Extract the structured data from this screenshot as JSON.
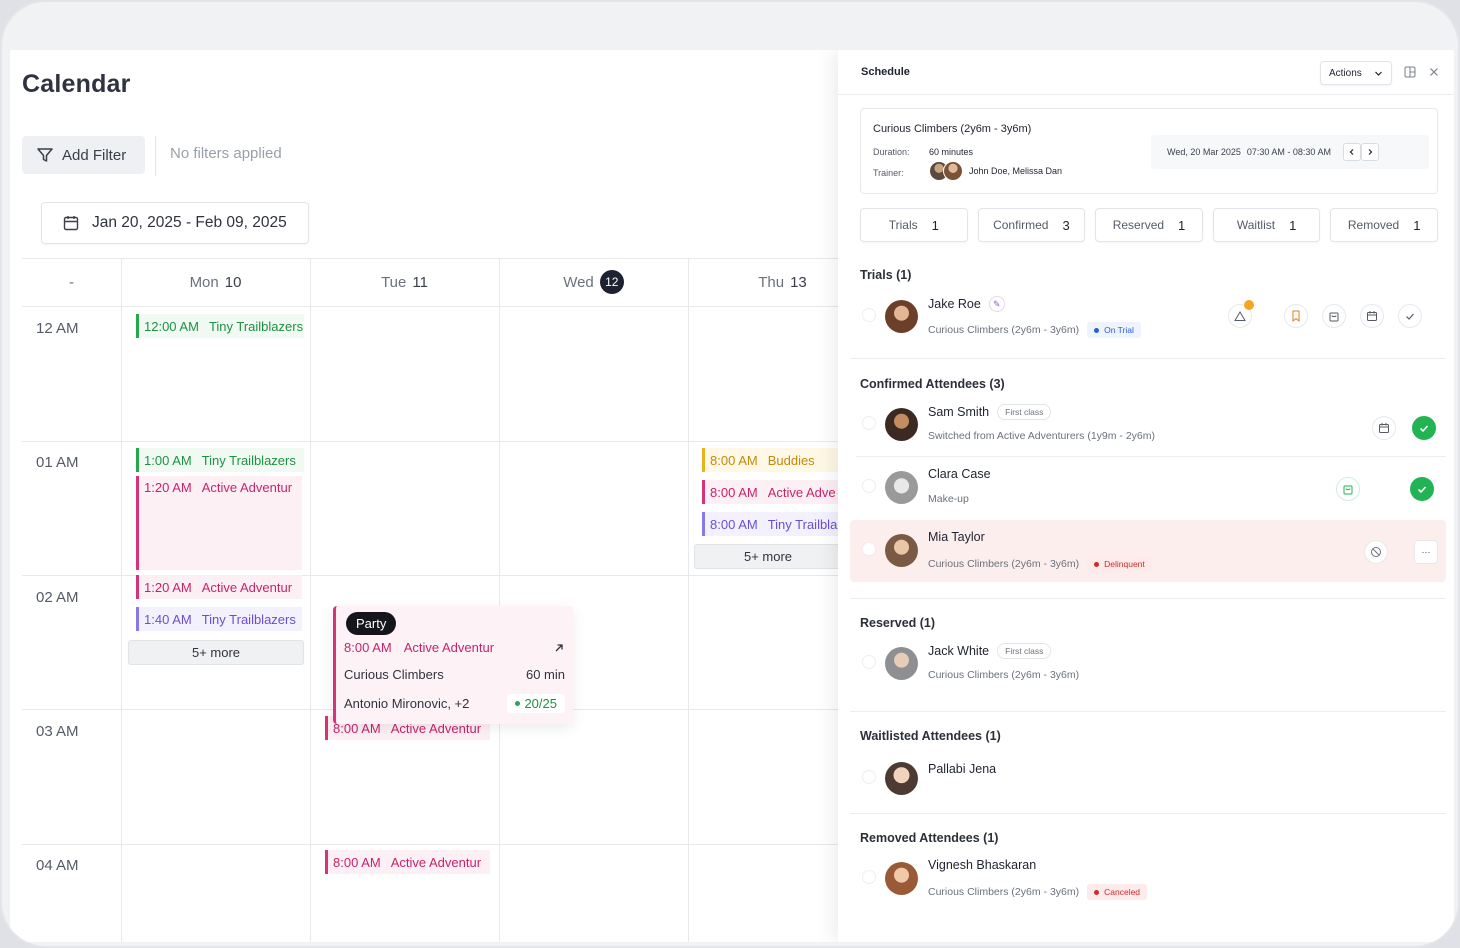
{
  "calendar": {
    "title": "Calendar",
    "add_filter": "Add Filter",
    "no_filters": "No filters applied",
    "date_range": "Jan 20, 2025 - Feb 09, 2025",
    "corner": "-",
    "days": [
      {
        "name": "Mon",
        "num": "10"
      },
      {
        "name": "Tue",
        "num": "11"
      },
      {
        "name": "Wed",
        "num": "12"
      },
      {
        "name": "Thu",
        "num": "13"
      }
    ],
    "hours": [
      "12 AM",
      "01 AM",
      "02 AM",
      "03 AM",
      "04 AM"
    ],
    "events": {
      "mon_1": {
        "time": "12:00 AM",
        "name": "Tiny Trailblazers"
      },
      "mon_2": {
        "time": "1:00 AM",
        "name": "Tiny Trailblazers"
      },
      "mon_3": {
        "time": "1:20 AM",
        "name": "Active Adventur"
      },
      "mon_4": {
        "time": "1:20 AM",
        "name": "Active Adventur"
      },
      "mon_5": {
        "time": "1:40 AM",
        "name": "Tiny Trailblazers"
      },
      "mon_more": "5+ more",
      "thu_1": {
        "time": "8:00 AM",
        "name": "Buddies"
      },
      "thu_2": {
        "time": "8:00 AM",
        "name": "Active Adve"
      },
      "thu_3": {
        "time": "8:00 AM",
        "name": "Tiny Trailbla"
      },
      "thu_more": "5+ more",
      "tue_1": {
        "time": "8:00 AM",
        "name": "Active Adventur"
      },
      "tue_2": {
        "time": "8:00 AM",
        "name": "Active Adventur"
      }
    },
    "party": {
      "pill": "Party",
      "time": "8:00 AM",
      "name": "Active Adventur",
      "class": "Curious Climbers",
      "duration": "60 min",
      "trainers": "Antonio Mironovic, +2",
      "capacity": "20/25"
    }
  },
  "schedule": {
    "title": "Schedule",
    "actions": "Actions",
    "class_name": "Curious Climbers (2y6m - 3y6m)",
    "duration_label": "Duration:",
    "duration": "60 minutes",
    "trainer_label": "Trainer:",
    "trainers": "John Doe, Melissa Dan",
    "date": "Wed, 20 Mar 2025",
    "time": "07:30 AM - 08:30 AM",
    "tabs": [
      {
        "label": "Trials",
        "count": "1"
      },
      {
        "label": "Confirmed",
        "count": "3"
      },
      {
        "label": "Reserved",
        "count": "1"
      },
      {
        "label": "Waitlist",
        "count": "1"
      },
      {
        "label": "Removed",
        "count": "1"
      }
    ],
    "sections": {
      "trials": "Trials (1)",
      "confirmed": "Confirmed Attendees (3)",
      "reserved": "Reserved (1)",
      "waitlisted": "Waitlisted Attendees (1)",
      "removed": "Removed Attendees (1)"
    },
    "attendees": {
      "jake": {
        "name": "Jake Roe",
        "sub": "Curious Climbers (2y6m - 3y6m)",
        "badge": "On Trial"
      },
      "sam": {
        "name": "Sam Smith",
        "tag": "First class",
        "sub": "Switched from Active Adventurers (1y9m - 2y6m)"
      },
      "clara": {
        "name": "Clara Case",
        "sub": "Make-up"
      },
      "mia": {
        "name": "Mia Taylor",
        "sub": "Curious Climbers (2y6m - 3y6m)",
        "badge": "Delinquent"
      },
      "jack": {
        "name": "Jack White",
        "tag": "First class",
        "sub": "Curious Climbers (2y6m - 3y6m)"
      },
      "pallabi": {
        "name": "Pallabi Jena"
      },
      "vignesh": {
        "name": "Vignesh Bhaskaran",
        "sub": "Curious Climbers (2y6m - 3y6m)",
        "badge": "Canceled"
      }
    },
    "more": "···"
  },
  "colors": {
    "green": "#29a74d",
    "pink": "#d6337a",
    "purple": "#8a78e6",
    "yellow": "#e8b320",
    "today": "#1d2130"
  }
}
